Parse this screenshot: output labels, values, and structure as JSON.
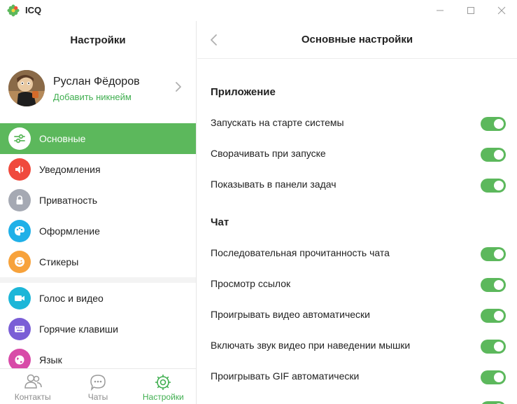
{
  "window": {
    "title": "ICQ",
    "icons": {
      "logo": "icq-flower-icon",
      "minimize": "minimize-icon",
      "maximize": "maximize-icon",
      "close": "close-icon"
    }
  },
  "sidebar": {
    "title": "Настройки",
    "profile": {
      "name": "Руслан Фёдоров",
      "nickname_link": "Добавить никнейм"
    },
    "items": [
      {
        "label": "Основные",
        "icon": "sliders-icon",
        "color": "#5cb85c",
        "active": true
      },
      {
        "label": "Уведомления",
        "icon": "speaker-icon",
        "color": "#f04a3d",
        "active": false
      },
      {
        "label": "Приватность",
        "icon": "lock-icon",
        "color": "#a5a9b3",
        "active": false
      },
      {
        "label": "Оформление",
        "icon": "palette-icon",
        "color": "#1fb0e8",
        "active": false
      },
      {
        "label": "Стикеры",
        "icon": "smiley-icon",
        "color": "#f7a23b",
        "active": false
      },
      {
        "label": "Голос и видео",
        "icon": "video-camera-icon",
        "color": "#1cb6d8",
        "active": false
      },
      {
        "label": "Горячие клавиши",
        "icon": "keyboard-icon",
        "color": "#7a5ed6",
        "active": false
      },
      {
        "label": "Язык",
        "icon": "globe-icon",
        "color": "#d84ba8",
        "active": false
      }
    ]
  },
  "tabbar": {
    "tabs": [
      {
        "label": "Контакты",
        "icon": "contacts-icon",
        "active": false
      },
      {
        "label": "Чаты",
        "icon": "chat-bubble-icon",
        "active": false
      },
      {
        "label": "Настройки",
        "icon": "settings-gear-icon",
        "active": true
      }
    ]
  },
  "main": {
    "title": "Основные настройки",
    "sections": [
      {
        "title": "Приложение",
        "rows": [
          {
            "label": "Запускать на старте системы",
            "enabled": true
          },
          {
            "label": "Сворачивать при запуске",
            "enabled": true
          },
          {
            "label": "Показывать в панели задач",
            "enabled": true
          }
        ]
      },
      {
        "title": "Чат",
        "rows": [
          {
            "label": "Последовательная прочитанность чата",
            "enabled": true
          },
          {
            "label": "Просмотр ссылок",
            "enabled": true
          },
          {
            "label": "Проигрывать видео автоматически",
            "enabled": true
          },
          {
            "label": "Включать звук видео при наведении мышки",
            "enabled": true
          },
          {
            "label": "Проигрывать GIF автоматически",
            "enabled": true
          }
        ]
      }
    ]
  },
  "colors": {
    "accent": "#5cb85c",
    "link": "#3fae4f"
  }
}
